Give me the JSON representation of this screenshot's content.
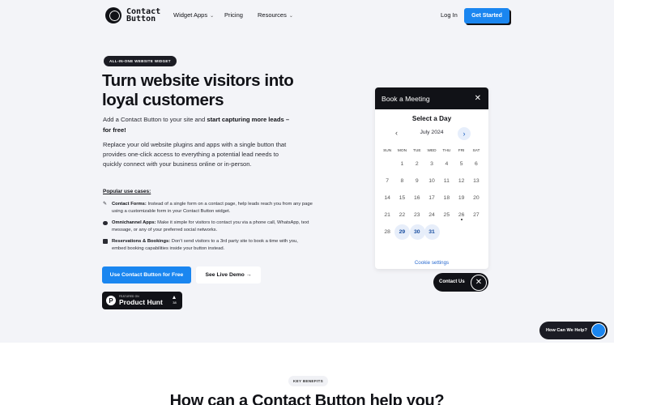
{
  "header": {
    "logo_line1": "Contact",
    "logo_line2": "Button",
    "nav": [
      {
        "label": "Widget Apps",
        "has_dropdown": true
      },
      {
        "label": "Pricing",
        "has_dropdown": false
      },
      {
        "label": "Resources",
        "has_dropdown": true
      }
    ],
    "login_label": "Log In",
    "get_started_label": "Get Started"
  },
  "hero": {
    "badge": "ALL-IN-ONE WEBSITE WIDGET",
    "headline": "Turn website visitors into loyal customers",
    "sub_plain": "Add a Contact Button to your site and ",
    "sub_bold": "start capturing more leads – for free!",
    "description": "Replace your old website plugins and apps with a single button that provides one-click access to everything a potential lead needs to quickly connect with your business online or in-person.",
    "use_cases_title": "Popular use cases:",
    "use_cases": [
      {
        "icon": "edit-icon",
        "title": "Contact Forms:",
        "text": " Instead of a single form on a contact page, help leads reach you from any page using a customizable form in your Contact Button widget."
      },
      {
        "icon": "chat-icon",
        "title": "Omnichannel Apps:",
        "text": " Make it simple for visitors to contact you via a phone call, WhatsApp, text message, or any of your preferred social networks."
      },
      {
        "icon": "calendar-icon",
        "title": "Reservations & Bookings:",
        "text": " Don't send visitors to a 3rd party site to book a time with you, embed booking capabilities inside your button instead."
      }
    ],
    "cta_primary": "Use Contact Button for Free",
    "cta_secondary": "See Live Demo →",
    "product_hunt": {
      "featured": "FEATURED ON",
      "name": "Product Hunt",
      "logo_letter": "P",
      "upvotes": "38"
    }
  },
  "booking": {
    "title": "Book a Meeting",
    "close": "✕",
    "heading": "Select a Day",
    "prev": "‹",
    "month": "July 2024",
    "next": "›",
    "weekdays": [
      "SUN",
      "MON",
      "TUE",
      "WED",
      "THU",
      "FRI",
      "SAT"
    ],
    "first_weekday_offset": 1,
    "days_in_month": 31,
    "available_days": [
      29,
      30,
      31
    ],
    "today": 26,
    "cookie_settings": "Cookie settings"
  },
  "contact_widget": {
    "label": "Contact Us",
    "close": "✕"
  },
  "help_widget": {
    "label": "How Can We Help?"
  },
  "benefits": {
    "badge": "KEY BENEFITS",
    "title": "How can a Contact Button help you?"
  },
  "colors": {
    "accent": "#1a86f0",
    "dark": "#111217",
    "hero_bg": "#f3f4f8"
  }
}
